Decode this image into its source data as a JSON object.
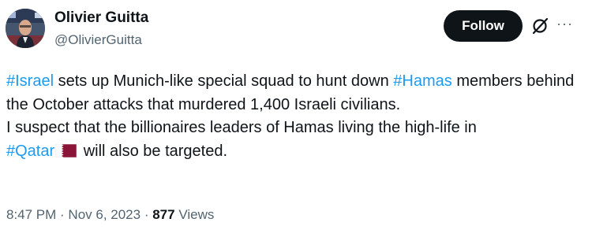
{
  "author": {
    "name": "Olivier Guitta",
    "handle": "@OlivierGuitta"
  },
  "actions": {
    "follow_label": "Follow",
    "grok_icon": "grok-slash-circle-icon",
    "more_icon": "more-dots-icon",
    "more_glyph": "···"
  },
  "tweet": {
    "hashtag_israel": "#Israel",
    "text_1": " sets up Munich-like special squad to hunt down ",
    "hashtag_hamas": "#Hamas",
    "text_2": " members behind the October attacks that murdered 1,400 Israeli civilians.",
    "text_3": "I suspect that the billionaires leaders of Hamas living the high-life in",
    "hashtag_qatar": "#Qatar",
    "flag_icon": "qatar-flag-icon",
    "text_4": " will also be targeted."
  },
  "meta": {
    "time": "8:47 PM",
    "sep1": " · ",
    "date": "Nov 6, 2023",
    "sep2": " · ",
    "views_count": "877",
    "views_label": " Views"
  },
  "colors": {
    "link": "#1d9bf0",
    "text": "#0f1419",
    "secondary": "#536471",
    "follow_bg": "#0f1419",
    "qatar_maroon": "#8a1538"
  }
}
